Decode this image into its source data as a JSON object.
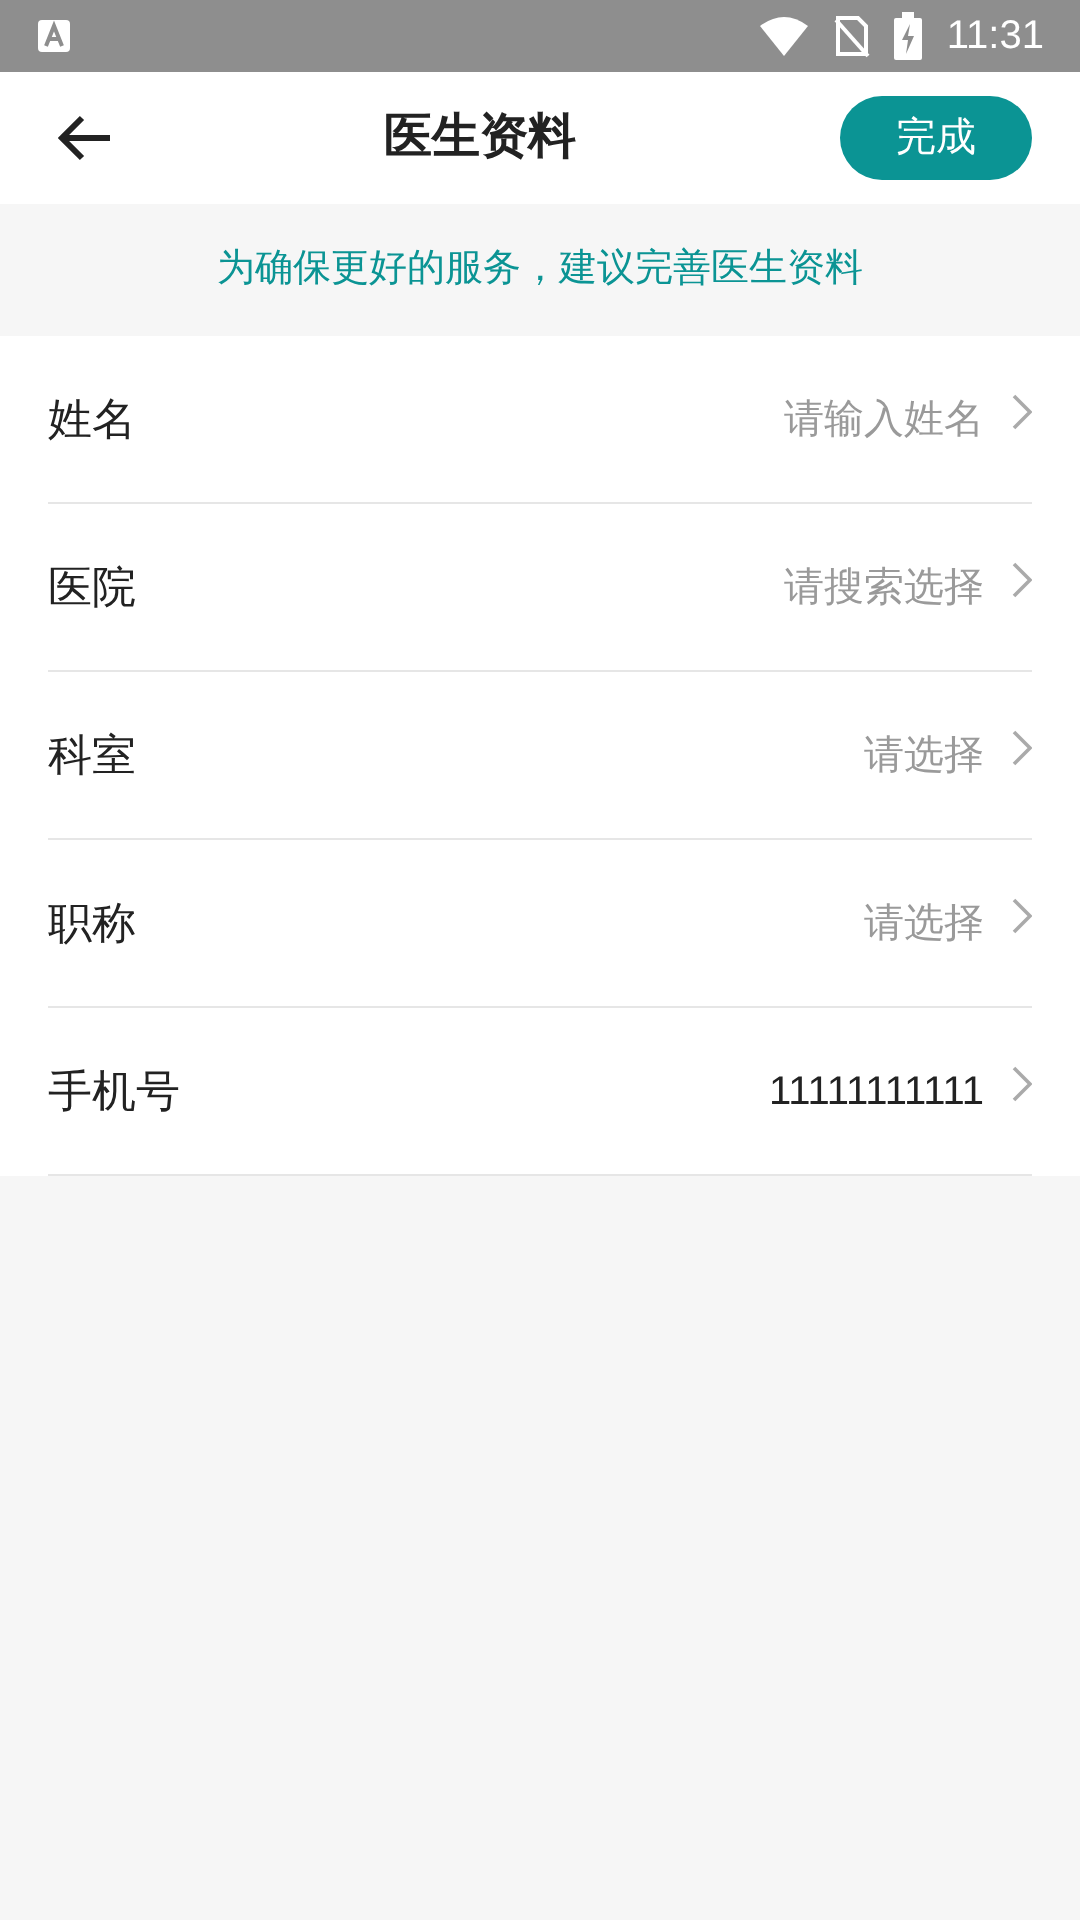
{
  "status_bar": {
    "time": "11:31"
  },
  "header": {
    "title": "医生资料",
    "done_button": "完成"
  },
  "notice": "为确保更好的服务，建议完善医生资料",
  "rows": [
    {
      "label": "姓名",
      "placeholder": "请输入姓名"
    },
    {
      "label": "医院",
      "placeholder": "请搜索选择"
    },
    {
      "label": "科室",
      "placeholder": "请选择"
    },
    {
      "label": "职称",
      "placeholder": "请选择"
    },
    {
      "label": "手机号",
      "value": "11111111111"
    }
  ]
}
